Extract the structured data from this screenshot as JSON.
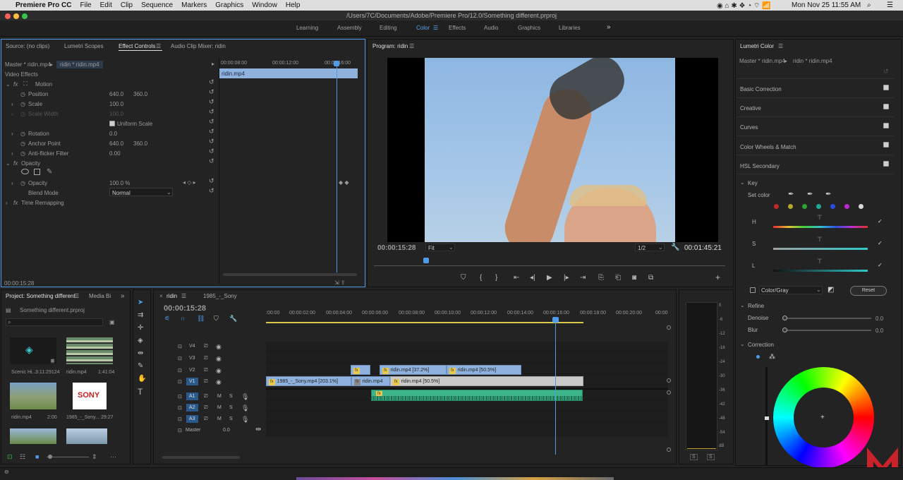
{
  "menubar": {
    "app": "Premiere Pro CC",
    "items": [
      "File",
      "Edit",
      "Clip",
      "Sequence",
      "Markers",
      "Graphics",
      "Window",
      "Help"
    ],
    "clock": "Mon Nov 25  11:55 AM"
  },
  "title": "/Users/7C/Documents/Adobe/Premiere Pro/12.0/Something different.prproj",
  "workspaces": [
    "Learning",
    "Assembly",
    "Editing",
    "Color",
    "Effects",
    "Audio",
    "Graphics",
    "Libraries"
  ],
  "active_workspace": "Color",
  "source_panel": {
    "tabs": [
      "Source: (no clips)",
      "Lumetri Scopes",
      "Effect Controls",
      "Audio Clip Mixer: ridin"
    ],
    "master": "Master * ridin.mp4",
    "seq": "ridin * ridin.mp4",
    "section": "Video Effects",
    "clip_label": "ridin.mp4",
    "timecode": "00:00:15:28",
    "ruler": [
      "00:00:08:00",
      "00:00:12:00",
      "00:00:16:00"
    ],
    "props": {
      "motion": "Motion",
      "position": "Position",
      "pos_x": "640.0",
      "pos_y": "360.0",
      "scale": "Scale",
      "scale_v": "100.0",
      "scale_width": "Scale Width",
      "scale_width_v": "100.0",
      "uniform": "Uniform Scale",
      "rotation": "Rotation",
      "rotation_v": "0.0",
      "anchor": "Anchor Point",
      "anchor_x": "640.0",
      "anchor_y": "360.0",
      "antiflicker": "Anti-flicker Filter",
      "antiflicker_v": "0.00",
      "opacity_group": "Opacity",
      "opacity": "Opacity",
      "opacity_v": "100.0 %",
      "blend": "Blend Mode",
      "blend_v": "Normal",
      "time_remap": "Time Remapping"
    }
  },
  "program": {
    "title": "Program: ridin",
    "timecode": "00:00:15:28",
    "fit": "Fit",
    "quality": "1/2",
    "duration": "00:01:45:21"
  },
  "project": {
    "title": "Project: Something different",
    "tab2": "Media Bi",
    "file": "Something different.prproj",
    "items": [
      {
        "name": "Scenic Hi...",
        "dur": "3:11:29124"
      },
      {
        "name": "ridin.mp4",
        "dur": "1:41:04"
      },
      {
        "name": "ridin.mp4",
        "dur": "2:00"
      },
      {
        "name": "1985_-_Sony...",
        "dur": "29:27"
      }
    ],
    "sony_text": "SONY"
  },
  "timeline": {
    "tabs": [
      "ridin",
      "1985_-_Sony"
    ],
    "timecode": "00:00:15:28",
    "ruler": [
      ":00:00",
      "00:00:02:00",
      "00:00:04:00",
      "00:00:06:00",
      "00:00:08:00",
      "00:00:10:00",
      "00:00:12:00",
      "00:00:14:00",
      "00:00:16:00",
      "00:00:18:00",
      "00:00:20:00",
      "00:00"
    ],
    "tracks": [
      "V4",
      "V3",
      "V2",
      "V1",
      "A1",
      "A2",
      "A3"
    ],
    "master": "Master",
    "master_v": "0.0",
    "mute": "M",
    "solo": "S",
    "clips": {
      "v2a": "ridin.mp4 [37.2%]",
      "v2b": "ridin.mp4 [50.5%]",
      "v1a": "1985_-_Sony.mp4 [203.1%]",
      "v1b": "ridin.mp4",
      "v1c": "ridin.mp4 [50.5%]"
    },
    "fx": "fx"
  },
  "meter": {
    "ticks": [
      "0",
      "-6",
      "-12",
      "-18",
      "-24",
      "-30",
      "-36",
      "-42",
      "-48",
      "-54",
      "dB"
    ],
    "s": "S"
  },
  "lumetri": {
    "title": "Lumetri Color",
    "master": "Master * ridin.mp4",
    "seq": "ridin * ridin.mp4",
    "sections": [
      "Basic Correction",
      "Creative",
      "Curves",
      "Color Wheels & Match",
      "HSL Secondary"
    ],
    "key": "Key",
    "set_color": "Set color",
    "h": "H",
    "s": "S",
    "l": "L",
    "color_gray": "Color/Gray",
    "reset": "Reset",
    "refine": "Refine",
    "denoise": "Denoise",
    "denoise_v": "0.0",
    "blur": "Blur",
    "blur_v": "0.0",
    "correction": "Correction",
    "swatches": [
      "#c0282a",
      "#b4a626",
      "#2aa534",
      "#22a69a",
      "#2a4be0",
      "#b92ad0",
      "#d8d8d8"
    ]
  },
  "colors": {
    "accent": "#4f9bea",
    "audio_clip": "#3cb58a",
    "video_clip": "#8fb1dd",
    "watermark": "#c8232a"
  }
}
